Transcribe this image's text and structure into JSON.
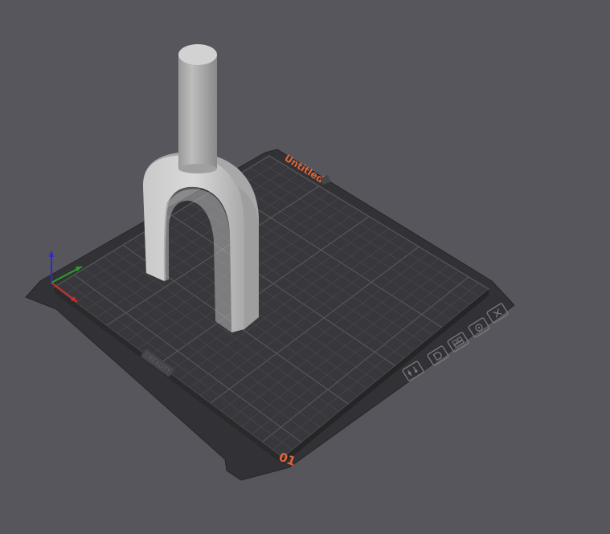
{
  "plate": {
    "name": "Untitled",
    "number": "01",
    "brand": "CREALITY"
  },
  "icons": {
    "plate_tools": [
      "settings-icon",
      "orient-icon",
      "arrange-icon",
      "lock-icon",
      "close-icon"
    ],
    "axes": [
      "x-axis-icon",
      "y-axis-icon",
      "z-axis-icon"
    ]
  },
  "colors": {
    "background": "#57565c",
    "plate": "#2f2f33",
    "grid": "#4a4a50",
    "accent": "#e0643a",
    "model": "#c8c8c8",
    "axis_x": "#d42a2a",
    "axis_y": "#2aa02a",
    "axis_z": "#2a2ad4"
  }
}
